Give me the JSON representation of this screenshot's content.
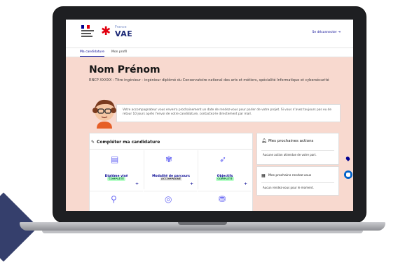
{
  "header": {
    "rf_lines": [
      "",
      "",
      ""
    ],
    "brand_small": "France",
    "brand_big": "VAE",
    "logout_label": "Se déconnecter"
  },
  "nav": {
    "tabs": [
      {
        "label": "Ma candidature",
        "active": true
      },
      {
        "label": "Mon profil",
        "active": false
      }
    ]
  },
  "hero": {
    "title": "Nom Prénom",
    "subtitle": "RNCP XXXXX : Titre ingénieur - ingénieur diplômé du Conservatoire national des arts et métiers, spécialité Informatique et cybersécurité",
    "message": "Votre accompagnateur vous enverra prochainement un date de rendez-vous pour parler de votre projet. Si vous n'avez toujours pas eu de retour 10 jours après l'envoi de votre candidature, contactez-le directement par mail."
  },
  "candidature": {
    "title": "Compléter ma candidature",
    "tiles": [
      {
        "badge": "COMPLÉTÉ",
        "badge_type": "green",
        "label": "Diplôme visé",
        "icon": "document-icon"
      },
      {
        "badge": "ACCOMPAGNÉ",
        "badge_type": "grey",
        "label": "Modalité de parcours",
        "icon": "path-icon"
      },
      {
        "badge": "COMPLÉTÉ",
        "badge_type": "green",
        "label": "Objectifs",
        "icon": "target-icon"
      }
    ],
    "tiles_row2": [
      {
        "icon": "experience-icon"
      },
      {
        "icon": "accompaniment-icon"
      },
      {
        "icon": "financing-icon"
      }
    ]
  },
  "actions": {
    "title": "Mes prochaines actions",
    "empty": "Aucune action attendue de votre part."
  },
  "rdv": {
    "title": "Mes prochains rendez-vous",
    "empty": "Aucun rendez-vous pour le moment."
  },
  "colors": {
    "brand_blue": "#000091",
    "band": "#f8d9cf",
    "flag_blue": "#000091",
    "flag_red": "#e1000f"
  }
}
